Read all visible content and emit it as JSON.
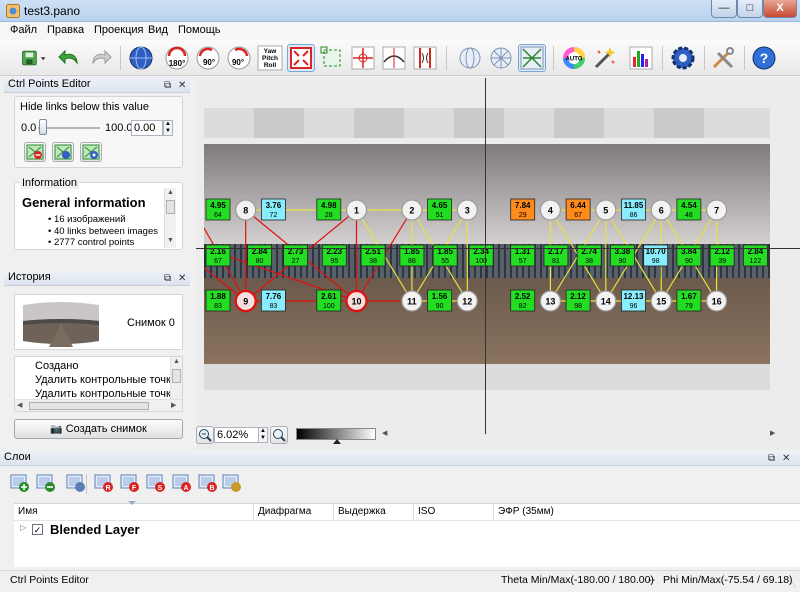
{
  "window": {
    "title": "test3.pano",
    "min_label": "—",
    "max_label": "□",
    "close_label": "X"
  },
  "menu": [
    "Файл",
    "Правка",
    "Проекция",
    "Вид",
    "Помощь"
  ],
  "toolbar": {
    "buttons": [
      "save-icon",
      "undo-icon",
      "redo-icon",
      "preview-globe-icon",
      "rotate-180-icon",
      "rotate-90-cw-icon",
      "rotate-90-ccw-icon",
      "yaw-pitch-roll-icon",
      "fit-frame-icon",
      "crop-icon",
      "center-icon",
      "straighten-icon",
      "stretch-icon",
      "projection-sphere-icon",
      "projection-grid-icon",
      "show-links-icon",
      "auto-color-icon",
      "tools-wand-icon",
      "histogram-icon",
      "settings-gear-icon",
      "preferences-tools-icon",
      "help-icon"
    ],
    "labels": {
      "r180": "180°",
      "r90a": "90°",
      "r90b": "90°",
      "ypr": "Yaw\nPitch\nRoll",
      "auto": "AUTO"
    }
  },
  "cp_editor": {
    "title": "Ctrl Points Editor",
    "hide_label": "Hide links below this value",
    "slider_min": "0.0",
    "slider_max": "100.0",
    "value": "0.00",
    "info_label": "Information",
    "info_heading": "General information",
    "info_items": [
      "16 изображений",
      "40 links between images",
      "2777 control points"
    ]
  },
  "history": {
    "title": "История",
    "snapshot_label": "Снимок 0",
    "items": [
      "Создано",
      "Удалить контрольные точки",
      "Удалить контрольные точки"
    ],
    "create_button": "Создать снимок"
  },
  "preview": {
    "zoom": "6.02%",
    "images": [
      {
        "n": "1",
        "row": 1,
        "col": 5
      },
      {
        "n": "2",
        "row": 1,
        "col": 7
      },
      {
        "n": "3",
        "row": 1,
        "col": 9
      },
      {
        "n": "4",
        "row": 1,
        "col": 12
      },
      {
        "n": "5",
        "row": 1,
        "col": 14
      },
      {
        "n": "6",
        "row": 1,
        "col": 16
      },
      {
        "n": "7",
        "row": 1,
        "col": 18
      },
      {
        "n": "8",
        "row": 1,
        "col": 1
      },
      {
        "n": "9",
        "row": 3,
        "col": 1,
        "red": true
      },
      {
        "n": "10",
        "row": 3,
        "col": 5,
        "red": true
      },
      {
        "n": "11",
        "row": 3,
        "col": 7
      },
      {
        "n": "12",
        "row": 3,
        "col": 9
      },
      {
        "n": "13",
        "row": 3,
        "col": 12
      },
      {
        "n": "14",
        "row": 3,
        "col": 14
      },
      {
        "n": "15",
        "row": 3,
        "col": 16
      },
      {
        "n": "16",
        "row": 3,
        "col": 18
      }
    ],
    "links": [
      {
        "row": 1,
        "col": 0,
        "v": "4.95",
        "c": "64",
        "color": "#22dd22"
      },
      {
        "row": 1,
        "col": 2,
        "v": "3.76",
        "c": "72",
        "color": "#88eeff"
      },
      {
        "row": 1,
        "col": 4,
        "v": "4.98",
        "c": "28",
        "color": "#22dd22"
      },
      {
        "row": 1,
        "col": 8,
        "v": "4.65",
        "c": "51",
        "color": "#22dd22"
      },
      {
        "row": 1,
        "col": 11,
        "v": "7.84",
        "c": "29",
        "color": "#ff8c1a"
      },
      {
        "row": 1,
        "col": 13,
        "v": "6.44",
        "c": "67",
        "color": "#ff8c1a"
      },
      {
        "row": 1,
        "col": 15,
        "v": "11.85",
        "c": "86",
        "color": "#88eeff"
      },
      {
        "row": 1,
        "col": 17,
        "v": "4.54",
        "c": "48",
        "color": "#22dd22"
      },
      {
        "row": 2,
        "col": 0,
        "v": "2.16",
        "c": "67",
        "color": "#22dd22"
      },
      {
        "row": 2,
        "col": 1.5,
        "v": "2.84",
        "c": "80",
        "color": "#22dd22"
      },
      {
        "row": 2,
        "col": 2.8,
        "v": "2.73",
        "c": "27",
        "color": "#22dd22"
      },
      {
        "row": 2,
        "col": 4.2,
        "v": "2.23",
        "c": "95",
        "color": "#22dd22"
      },
      {
        "row": 2,
        "col": 5.6,
        "v": "2.51",
        "c": "38",
        "color": "#22dd22"
      },
      {
        "row": 2,
        "col": 7,
        "v": "1.85",
        "c": "88",
        "color": "#22dd22"
      },
      {
        "row": 2,
        "col": 8.2,
        "v": "1.85",
        "c": "55",
        "color": "#22dd22"
      },
      {
        "row": 2,
        "col": 9.5,
        "v": "2.34",
        "c": "100",
        "color": "#22dd22"
      },
      {
        "row": 2,
        "col": 11,
        "v": "1.31",
        "c": "57",
        "color": "#22dd22"
      },
      {
        "row": 2,
        "col": 12.2,
        "v": "2.17",
        "c": "81",
        "color": "#22dd22"
      },
      {
        "row": 2,
        "col": 13.4,
        "v": "2.74",
        "c": "38",
        "color": "#22dd22"
      },
      {
        "row": 2,
        "col": 14.6,
        "v": "3.38",
        "c": "90",
        "color": "#22dd22"
      },
      {
        "row": 2,
        "col": 15.8,
        "v": "10.70",
        "c": "98",
        "color": "#88eeff"
      },
      {
        "row": 2,
        "col": 17,
        "v": "3.84",
        "c": "90",
        "color": "#22dd22"
      },
      {
        "row": 2,
        "col": 18.2,
        "v": "2.12",
        "c": "39",
        "color": "#22dd22"
      },
      {
        "row": 2,
        "col": 19.4,
        "v": "2.84",
        "c": "122",
        "color": "#22dd22"
      },
      {
        "row": 3,
        "col": 0,
        "v": "1.88",
        "c": "83",
        "color": "#22dd22"
      },
      {
        "row": 3,
        "col": 2,
        "v": "7.76",
        "c": "83",
        "color": "#88eeff"
      },
      {
        "row": 3,
        "col": 4,
        "v": "2.61",
        "c": "100",
        "color": "#22dd22"
      },
      {
        "row": 3,
        "col": 8,
        "v": "1.56",
        "c": "90",
        "color": "#22dd22"
      },
      {
        "row": 3,
        "col": 11,
        "v": "2.52",
        "c": "82",
        "color": "#22dd22"
      },
      {
        "row": 3,
        "col": 13,
        "v": "2.12",
        "c": "98",
        "color": "#22dd22"
      },
      {
        "row": 3,
        "col": 15,
        "v": "12.13",
        "c": "96",
        "color": "#88eeff"
      },
      {
        "row": 3,
        "col": 17,
        "v": "1.67",
        "c": "79",
        "color": "#22dd22"
      }
    ]
  },
  "layers": {
    "title": "Слои",
    "columns": [
      "Имя",
      "Диафрагма",
      "Выдержка",
      "ISO",
      "ЭФР (35мм)"
    ],
    "rows": [
      {
        "name": "Blended Layer",
        "checked": true
      }
    ],
    "tool_icons": [
      "add-layer-icon",
      "remove-layer-icon",
      "layer-props-icon",
      "layer-r-icon",
      "layer-f-icon",
      "layer-s-icon",
      "layer-a-icon",
      "layer-b-icon",
      "layer-notes-icon"
    ],
    "tool_letters": [
      "",
      "",
      "",
      "R",
      "F",
      "S",
      "A",
      "B",
      ""
    ]
  },
  "status": {
    "left": "Ctrl Points Editor",
    "theta": "Theta Min/Max(-180.00 / 180.00)",
    "sep": "--",
    "phi": "Phi Min/Max(-75.54 / 69.18)"
  }
}
